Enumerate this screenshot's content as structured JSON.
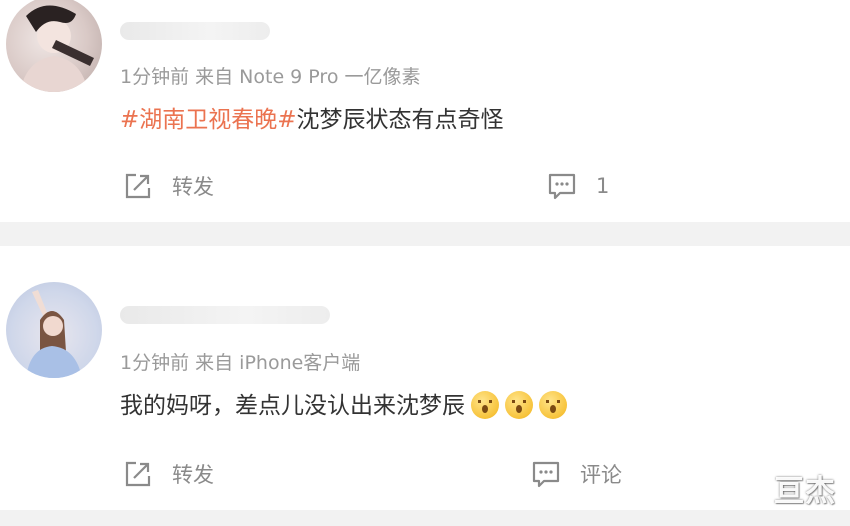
{
  "posts": [
    {
      "meta": "1分钟前  来自 Note 9 Pro 一亿像素",
      "content": {
        "hashtag": "#湖南卫视春晚#",
        "text": "沈梦辰状态有点奇怪"
      },
      "repost_label": "转发",
      "comment_label": "1",
      "avatar_icon": "avatar-photo"
    },
    {
      "meta": "1分钟前  来自 iPhone客户端",
      "content": {
        "text": "我的妈呀，差点儿没认出来沈梦辰"
      },
      "emoji_count": 3,
      "repost_label": "转发",
      "comment_label": "评论",
      "avatar_icon": "avatar-photo"
    }
  ],
  "watermark": "亘杰",
  "colors": {
    "hashtag": "#eb7350",
    "meta": "#9a9a9a",
    "text": "#333333",
    "divider": "#f2f2f2"
  },
  "icons": [
    "repost-icon",
    "comment-icon",
    "surprised-emoji-icon"
  ]
}
